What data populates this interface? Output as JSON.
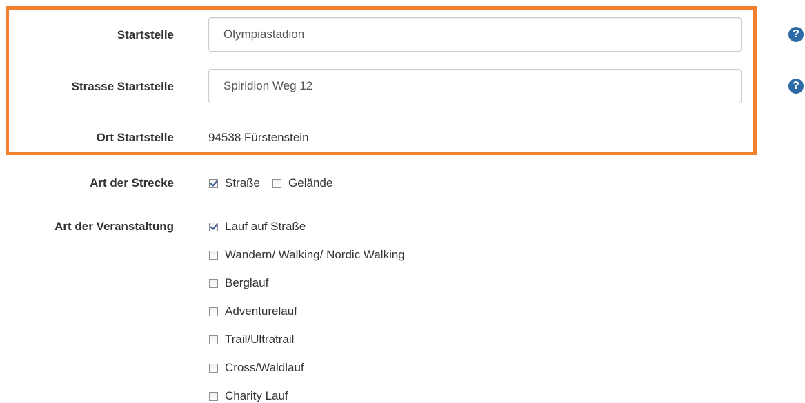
{
  "colors": {
    "highlight_border": "#f2812e",
    "help_icon_bg": "#2c6aa6",
    "check_color": "#2a4f8a"
  },
  "start": {
    "label": "Startstelle",
    "value": "Olympiastadion",
    "help_icon": "question-circle-icon",
    "help_symbol": "?"
  },
  "street": {
    "label": "Strasse Startstelle",
    "value": "Spiridion Weg 12",
    "help_icon": "question-circle-icon",
    "help_symbol": "?"
  },
  "place": {
    "label": "Ort Startstelle",
    "value": "94538 Fürstenstein"
  },
  "route_type": {
    "label": "Art der Strecke",
    "options": [
      {
        "label": "Straße",
        "checked": true
      },
      {
        "label": "Gelände",
        "checked": false
      }
    ]
  },
  "event_type": {
    "label": "Art der Veranstaltung",
    "options": [
      {
        "label": "Lauf auf Straße",
        "checked": true
      },
      {
        "label": "Wandern/ Walking/ Nordic Walking",
        "checked": false
      },
      {
        "label": "Berglauf",
        "checked": false
      },
      {
        "label": "Adventurelauf",
        "checked": false
      },
      {
        "label": "Trail/Ultratrail",
        "checked": false
      },
      {
        "label": "Cross/Waldlauf",
        "checked": false
      },
      {
        "label": "Charity Lauf",
        "checked": false
      }
    ]
  }
}
